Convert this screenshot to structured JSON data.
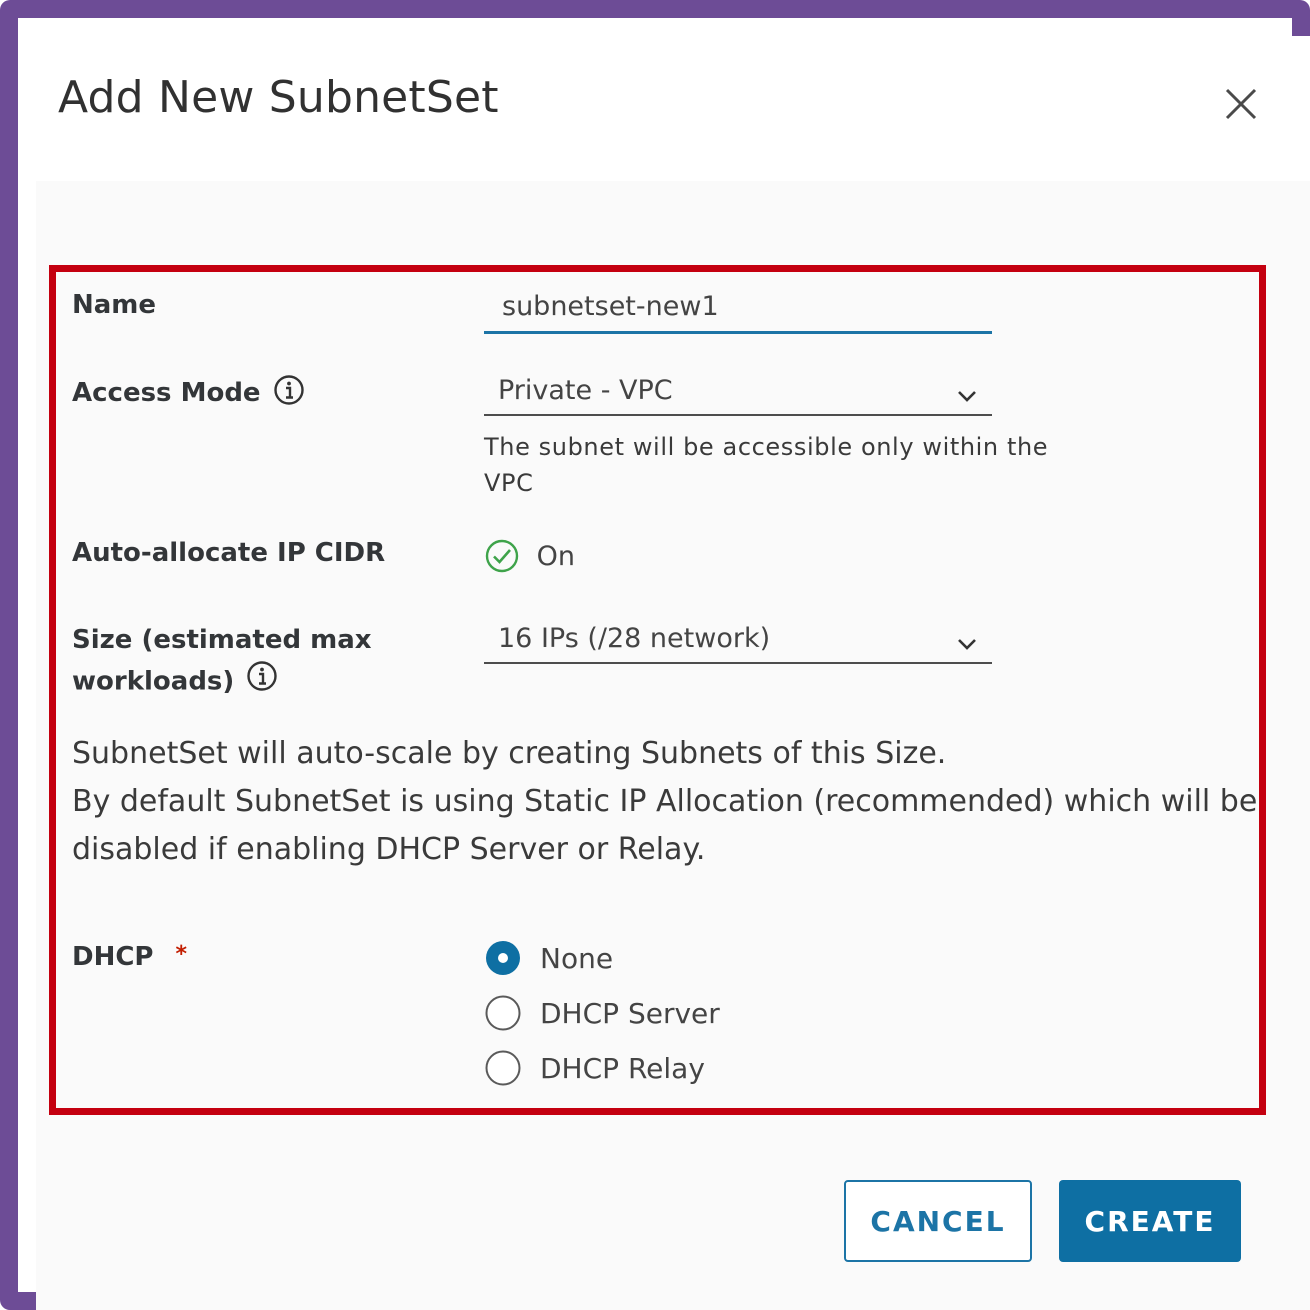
{
  "dialog": {
    "title": "Add New SubnetSet"
  },
  "form": {
    "name": {
      "label": "Name",
      "value": "subnetset-new1"
    },
    "access_mode": {
      "label": "Access Mode",
      "selected": "Private - VPC",
      "helper": "The subnet will be accessible only within the VPC"
    },
    "auto_allocate": {
      "label": "Auto-allocate IP CIDR",
      "state": "On"
    },
    "size": {
      "label_line1": "Size (estimated max",
      "label_line2": "workloads)",
      "selected": "16 IPs (/28 network)"
    },
    "description_line1": "SubnetSet will auto-scale by creating Subnets of this Size.",
    "description_line2": "By default SubnetSet is using Static IP Allocation (recommended) which will be disabled if enabling DHCP Server or Relay.",
    "dhcp": {
      "label": "DHCP",
      "required_mark": "*",
      "options": [
        "None",
        "DHCP Server",
        "DHCP Relay"
      ],
      "selected": "None"
    }
  },
  "footer": {
    "cancel_label": "CANCEL",
    "create_label": "CREATE"
  },
  "colors": {
    "frame": "#6d4c96",
    "highlight": "#c40010",
    "primary": "#0e6fa3",
    "success": "#3ea34a",
    "required": "#c21d00"
  }
}
